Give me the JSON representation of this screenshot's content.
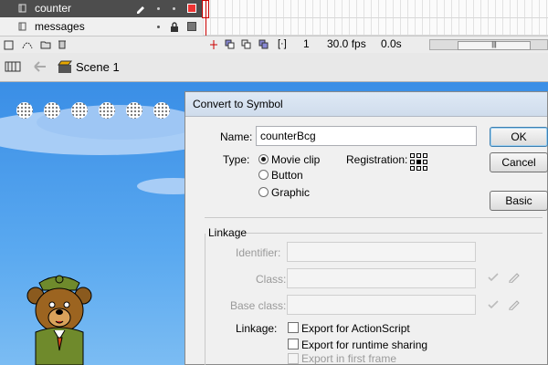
{
  "timeline": {
    "layers": [
      {
        "name": "counter",
        "selected": true
      },
      {
        "name": "messages",
        "selected": false
      }
    ],
    "frame_number": "1",
    "fps": "30.0 fps",
    "elapsed": "0.0s"
  },
  "editbar": {
    "scene": "Scene 1"
  },
  "dialog": {
    "title": "Convert to Symbol",
    "name_label": "Name:",
    "name_value": "counterBcg",
    "type_label": "Type:",
    "type_options": [
      "Movie clip",
      "Button",
      "Graphic"
    ],
    "type_selected": "Movie clip",
    "registration_label": "Registration:",
    "buttons": {
      "ok": "OK",
      "cancel": "Cancel",
      "basic": "Basic"
    },
    "linkage": {
      "section": "Linkage",
      "identifier_label": "Identifier:",
      "class_label": "Class:",
      "base_class_label": "Base class:",
      "linkage_label": "Linkage:",
      "export_actionscript": "Export for ActionScript",
      "export_runtime": "Export for runtime sharing",
      "export_first_frame": "Export in first frame"
    }
  },
  "colors": {
    "stage_blue": "#3a8fe8",
    "layer_selected": "#4d4d4d",
    "playhead": "#cc0000"
  }
}
